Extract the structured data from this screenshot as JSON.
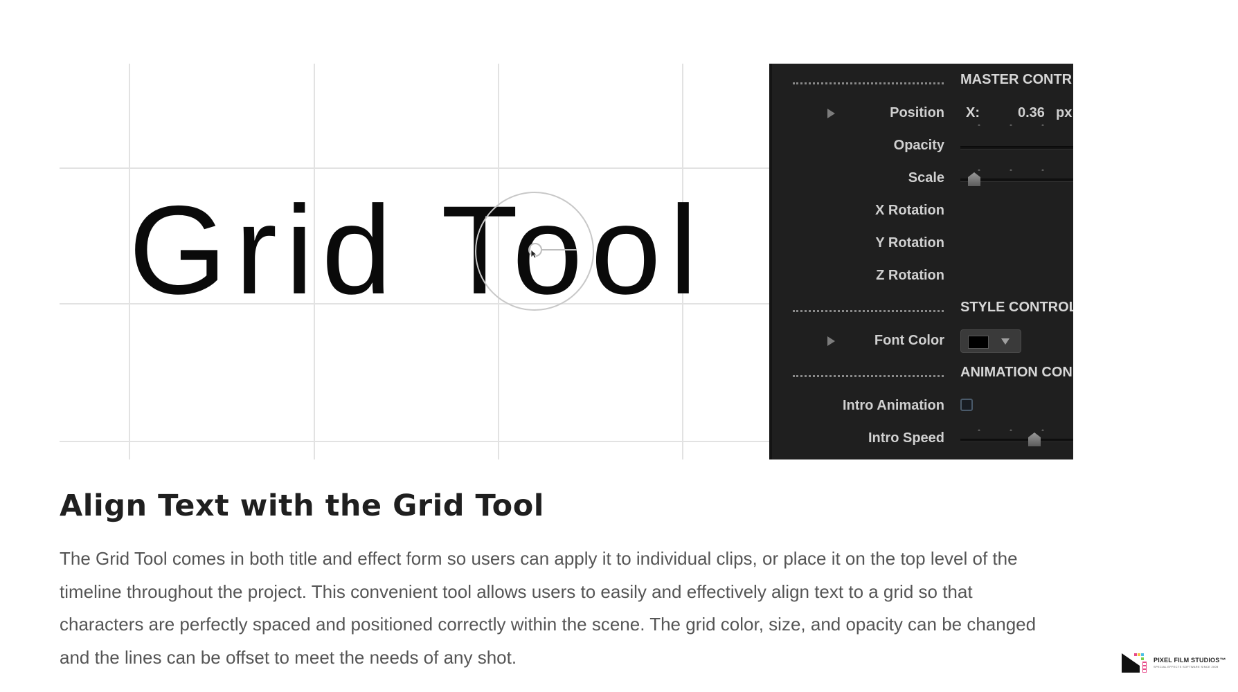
{
  "canvas": {
    "demo_text": "Grid Tool"
  },
  "inspector": {
    "sections": {
      "master": "MASTER CONTR",
      "style": "STYLE CONTROL",
      "animation": "ANIMATION CON"
    },
    "properties": {
      "position": "Position",
      "position_axis": "X:",
      "position_value": "0.36",
      "position_unit": "px",
      "opacity": "Opacity",
      "scale": "Scale",
      "x_rotation": "X Rotation",
      "y_rotation": "Y Rotation",
      "z_rotation": "Z Rotation",
      "font_color": "Font Color",
      "font_color_value": "#000000",
      "intro_animation": "Intro Animation",
      "intro_animation_checked": false,
      "intro_speed": "Intro Speed"
    }
  },
  "article": {
    "headline": "Align Text with the Grid Tool",
    "body_lines": [
      "The Grid Tool comes in both title and effect form so users can apply it to individual clips, or place it on the top level of the",
      "timeline throughout the project. This convenient tool allows users to easily and effectively align text to a grid so that",
      "characters are perfectly spaced and positioned correctly within the scene. The grid color, size, and opacity can be changed",
      "and the lines can be offset to meet the needs of any shot."
    ]
  },
  "logo": {
    "name": "PIXEL FILM STUDIOS™",
    "tagline": "SPECIAL EFFECTS SOFTWARE SINCE 2009"
  },
  "colors": {
    "panel_bg": "#1f1f1f",
    "headline": "#1f1f1f",
    "body": "#555555",
    "grid": "#e2e2e2"
  }
}
